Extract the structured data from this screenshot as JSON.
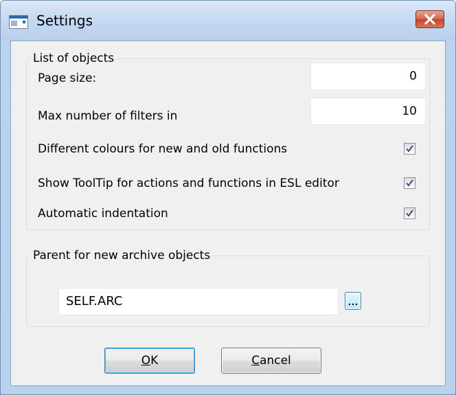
{
  "window": {
    "title": "Settings"
  },
  "list_group": {
    "legend": "List of objects",
    "page_size_label": "Page size:",
    "page_size_value": "0",
    "max_filters_label": "Max number of filters in",
    "max_filters_value": "10",
    "options": [
      {
        "label": "Different colours for new and old functions",
        "checked": true
      },
      {
        "label": "Show ToolTip for actions and functions in ESL editor",
        "checked": true
      },
      {
        "label": "Automatic indentation",
        "checked": true
      }
    ]
  },
  "parent_group": {
    "legend": "Parent for new archive objects",
    "value": "SELF.ARC"
  },
  "buttons": {
    "ok_mnemonic": "O",
    "ok_rest": "K",
    "cancel_mnemonic": "C",
    "cancel_rest": "ancel"
  },
  "icons": {
    "app": "window-app-icon",
    "close": "close-icon",
    "check": "checkmark-icon",
    "browse": "ellipsis-icon"
  },
  "colors": {
    "close_button": "#c9553c",
    "check_mark": "#3a4f93",
    "default_button_border": "#3c7fb1"
  }
}
